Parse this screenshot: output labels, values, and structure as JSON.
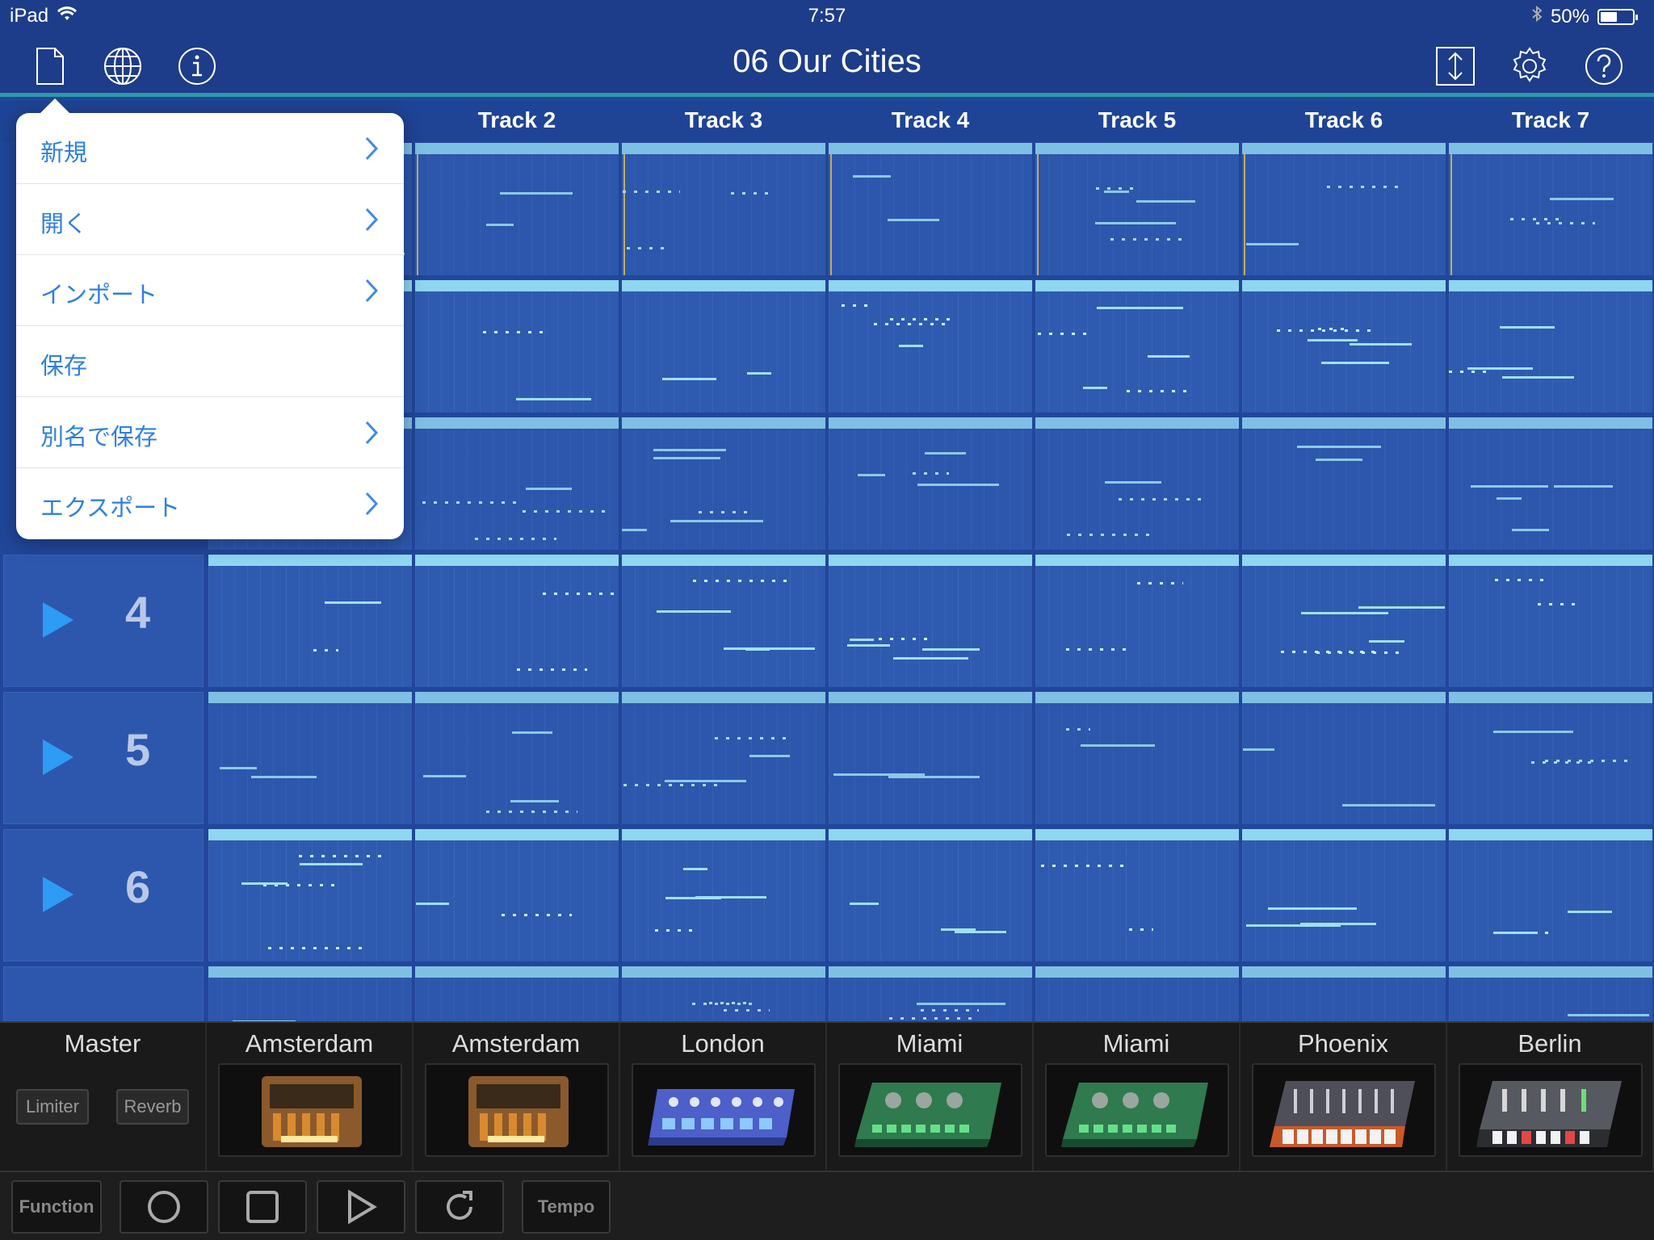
{
  "status": {
    "device": "iPad",
    "time": "7:57",
    "battery": "50%",
    "battery_level": 0.5
  },
  "document": {
    "title": "06 Our Cities"
  },
  "tracks": [
    {
      "header": "Track 2"
    },
    {
      "header": "Track 3"
    },
    {
      "header": "Track 4"
    },
    {
      "header": "Track 5"
    },
    {
      "header": "Track 6"
    },
    {
      "header": "Track 7"
    }
  ],
  "scenes": [
    {
      "number": "4"
    },
    {
      "number": "5"
    },
    {
      "number": "6"
    }
  ],
  "file_menu": {
    "items": [
      {
        "label": "新規",
        "has_submenu": true
      },
      {
        "label": "開く",
        "has_submenu": true
      },
      {
        "label": "インポート",
        "has_submenu": true
      },
      {
        "label": "保存",
        "has_submenu": false
      },
      {
        "label": "別名で保存",
        "has_submenu": true
      },
      {
        "label": "エクスポート",
        "has_submenu": true
      }
    ]
  },
  "mixer": {
    "master": {
      "label": "Master",
      "limiter": "Limiter",
      "reverb": "Reverb"
    },
    "instruments": [
      "Amsterdam",
      "Amsterdam",
      "London",
      "Miami",
      "Miami",
      "Phoenix",
      "Berlin"
    ]
  },
  "transport": {
    "function": "Function",
    "tempo": "Tempo"
  },
  "colors": {
    "background": "#21469a",
    "clip_bar": "#8fd6f0",
    "play_accent": "#2e9bf4",
    "menu_text": "#2f7fe0"
  }
}
